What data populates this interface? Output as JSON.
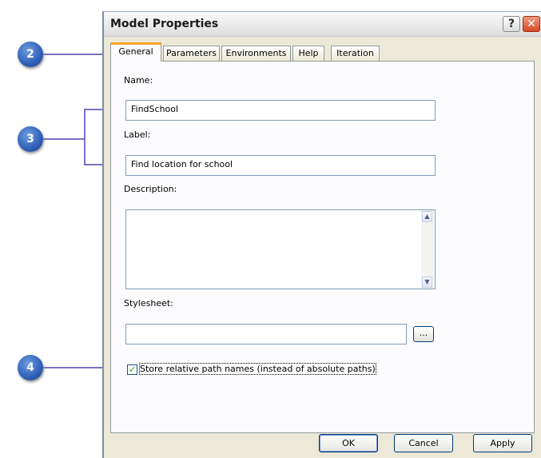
{
  "window": {
    "title": "Model Properties"
  },
  "titlebar": {
    "help_label": "?",
    "close_label": "✕"
  },
  "tabs": [
    {
      "label": "General"
    },
    {
      "label": "Parameters"
    },
    {
      "label": "Environments"
    },
    {
      "label": "Help"
    },
    {
      "label": "Iteration"
    }
  ],
  "form": {
    "name_label": "Name:",
    "name_value": "FindSchool",
    "label_label": "Label:",
    "label_value": "Find location for school",
    "description_label": "Description:",
    "description_value": "",
    "stylesheet_label": "Stylesheet:",
    "stylesheet_value": "",
    "browse_label": "...",
    "relative_paths_label": "Store relative path names (instead of absolute paths)",
    "relative_paths_checked": true,
    "check_glyph": "✓"
  },
  "buttons": {
    "ok": "OK",
    "cancel": "Cancel",
    "apply": "Apply"
  },
  "callouts": {
    "c2": "2",
    "c3": "3",
    "c4": "4"
  },
  "icons": {
    "scroll_up": "▲",
    "scroll_down": "▼"
  },
  "colors": {
    "callout": "#2f60b8",
    "callout_line": "#7d6fc2",
    "tab_highlight": "#f5a623"
  }
}
